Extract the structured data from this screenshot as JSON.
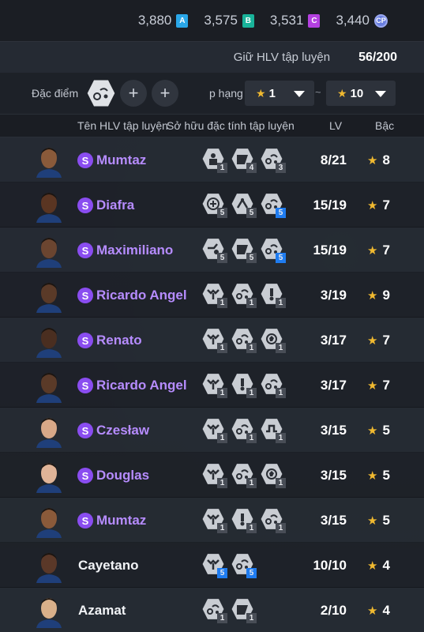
{
  "currency": [
    {
      "value": "3,880",
      "badge": "A",
      "color": "#2aa7e8"
    },
    {
      "value": "3,575",
      "badge": "B",
      "color": "#19b39a"
    },
    {
      "value": "3,531",
      "badge": "C",
      "color": "#b440e0"
    },
    {
      "value": "3,440",
      "badge": "CP",
      "color": "#6a7fe0"
    }
  ],
  "training": {
    "label": "Giữ HLV tập luyện",
    "value": "56/200"
  },
  "filter": {
    "trait_label": "Đặc điểm c",
    "rank_label": "p hạng",
    "rank_min": "1",
    "rank_max": "10",
    "tilde": "~",
    "plus": "+"
  },
  "columns": {
    "name": "Tên HLV tập luyện",
    "traits": "Sở hữu đặc tính tập luyện",
    "lv": "LV",
    "grade": "Bậc"
  },
  "coaches": [
    {
      "name": "Mumtaz",
      "special": true,
      "lv": "8/21",
      "grade": "8",
      "skin": "#8a5a3a",
      "traits": [
        {
          "icon": "player-icon",
          "level": "1",
          "blue": false
        },
        {
          "icon": "pitch-icon",
          "level": "4",
          "blue": false
        },
        {
          "icon": "pass-icon",
          "level": "3",
          "blue": false
        }
      ]
    },
    {
      "name": "Diafra",
      "special": true,
      "lv": "15/19",
      "grade": "7",
      "skin": "#5a3522",
      "traits": [
        {
          "icon": "tactic-icon",
          "level": "5",
          "blue": false
        },
        {
          "icon": "run-icon",
          "level": "5",
          "blue": false
        },
        {
          "icon": "pass-icon",
          "level": "5",
          "blue": true
        }
      ]
    },
    {
      "name": "Maximiliano",
      "special": true,
      "lv": "15/19",
      "grade": "7",
      "skin": "#6b4530",
      "traits": [
        {
          "icon": "kick-icon",
          "level": "5",
          "blue": false
        },
        {
          "icon": "pitch-icon",
          "level": "5",
          "blue": false
        },
        {
          "icon": "pass-icon",
          "level": "5",
          "blue": true
        }
      ]
    },
    {
      "name": "Ricardo Angel",
      "special": true,
      "lv": "3/19",
      "grade": "9",
      "skin": "#5a3a28",
      "traits": [
        {
          "icon": "fitness-icon",
          "level": "1",
          "blue": false
        },
        {
          "icon": "pass-icon",
          "level": "1",
          "blue": false
        },
        {
          "icon": "shoot-icon",
          "level": "1",
          "blue": false
        }
      ]
    },
    {
      "name": "Renato",
      "special": true,
      "lv": "3/17",
      "grade": "7",
      "skin": "#4a2e20",
      "traits": [
        {
          "icon": "fitness-icon",
          "level": "1",
          "blue": false
        },
        {
          "icon": "pass-icon",
          "level": "1",
          "blue": false
        },
        {
          "icon": "ball-icon",
          "level": "1",
          "blue": false
        }
      ]
    },
    {
      "name": "Ricardo Angel",
      "special": true,
      "lv": "3/17",
      "grade": "7",
      "skin": "#5a3a28",
      "traits": [
        {
          "icon": "fitness-icon",
          "level": "1",
          "blue": false
        },
        {
          "icon": "shoot-icon",
          "level": "1",
          "blue": false
        },
        {
          "icon": "pass-icon",
          "level": "1",
          "blue": false
        }
      ]
    },
    {
      "name": "Czesław",
      "special": true,
      "lv": "3/15",
      "grade": "5",
      "skin": "#d8a888",
      "traits": [
        {
          "icon": "fitness-icon",
          "level": "1",
          "blue": false
        },
        {
          "icon": "pass-icon",
          "level": "1",
          "blue": false
        },
        {
          "icon": "dribble-icon",
          "level": "1",
          "blue": false
        }
      ]
    },
    {
      "name": "Douglas",
      "special": true,
      "lv": "3/15",
      "grade": "5",
      "skin": "#e0b498",
      "traits": [
        {
          "icon": "fitness-icon",
          "level": "1",
          "blue": false
        },
        {
          "icon": "pass-icon",
          "level": "1",
          "blue": false
        },
        {
          "icon": "ball-icon",
          "level": "1",
          "blue": false
        }
      ]
    },
    {
      "name": "Mumtaz",
      "special": true,
      "lv": "3/15",
      "grade": "5",
      "skin": "#8a5a3a",
      "traits": [
        {
          "icon": "fitness-icon",
          "level": "1",
          "blue": false
        },
        {
          "icon": "shoot-icon",
          "level": "1",
          "blue": false
        },
        {
          "icon": "pass-icon",
          "level": "1",
          "blue": false
        }
      ]
    },
    {
      "name": "Cayetano",
      "special": false,
      "lv": "10/10",
      "grade": "4",
      "skin": "#5a3828",
      "traits": [
        {
          "icon": "fitness-icon",
          "level": "5",
          "blue": true
        },
        {
          "icon": "pass-icon",
          "level": "5",
          "blue": true
        }
      ]
    },
    {
      "name": "Azamat",
      "special": false,
      "lv": "2/10",
      "grade": "4",
      "skin": "#d9b08a",
      "traits": [
        {
          "icon": "pass-icon",
          "level": "1",
          "blue": false
        },
        {
          "icon": "pitch-icon",
          "level": "1",
          "blue": false
        }
      ]
    }
  ]
}
